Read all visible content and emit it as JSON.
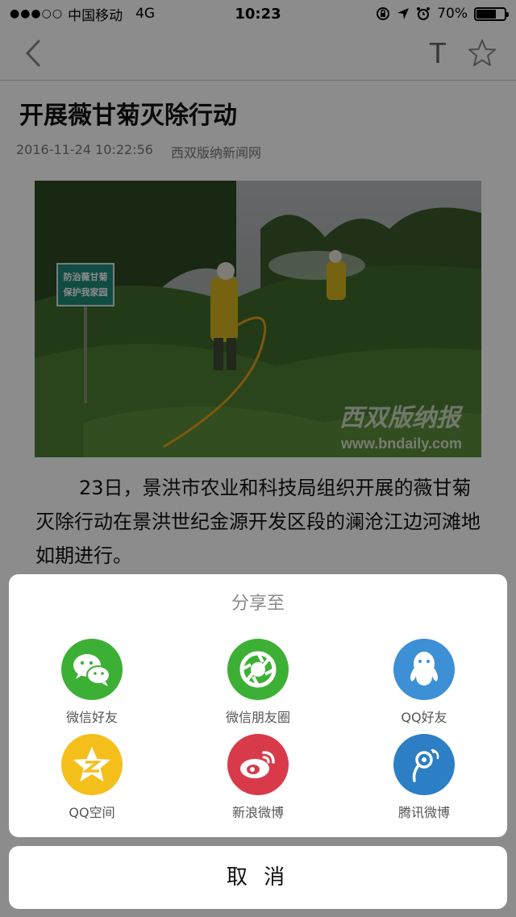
{
  "status_bar": {
    "carrier": "中国移动",
    "network": "4G",
    "time": "10:23",
    "battery": "70%",
    "battery_level": 0.7
  },
  "article": {
    "title": "开展薇甘菊灭除行动",
    "date": "2016-11-24 10:22:56",
    "source": "西双版纳新闻网",
    "image": {
      "sign_line1": "防治薇甘菊",
      "sign_line2": "保护我家园",
      "watermark_cn": "西双版纳报",
      "watermark_url": "www.bndaily.com"
    },
    "body": "23日，景洪市农业和科技局组织开展的薇甘菊灭除行动在景洪世纪金源开发区段的澜沧江边河滩地如期进行。"
  },
  "share": {
    "title": "分享至",
    "items": [
      {
        "label": "微信好友",
        "icon": "wechat-icon",
        "color": "#3cb034"
      },
      {
        "label": "微信朋友圈",
        "icon": "moments-icon",
        "color": "#3cb034"
      },
      {
        "label": "QQ好友",
        "icon": "qq-icon",
        "color": "#3d8fd6"
      },
      {
        "label": "QQ空间",
        "icon": "qzone-icon",
        "color": "#f5bf1b"
      },
      {
        "label": "新浪微博",
        "icon": "weibo-icon",
        "color": "#d93a4a"
      },
      {
        "label": "腾讯微博",
        "icon": "tencent-weibo-icon",
        "color": "#2c7fc4"
      }
    ],
    "cancel_label": "取 消"
  }
}
